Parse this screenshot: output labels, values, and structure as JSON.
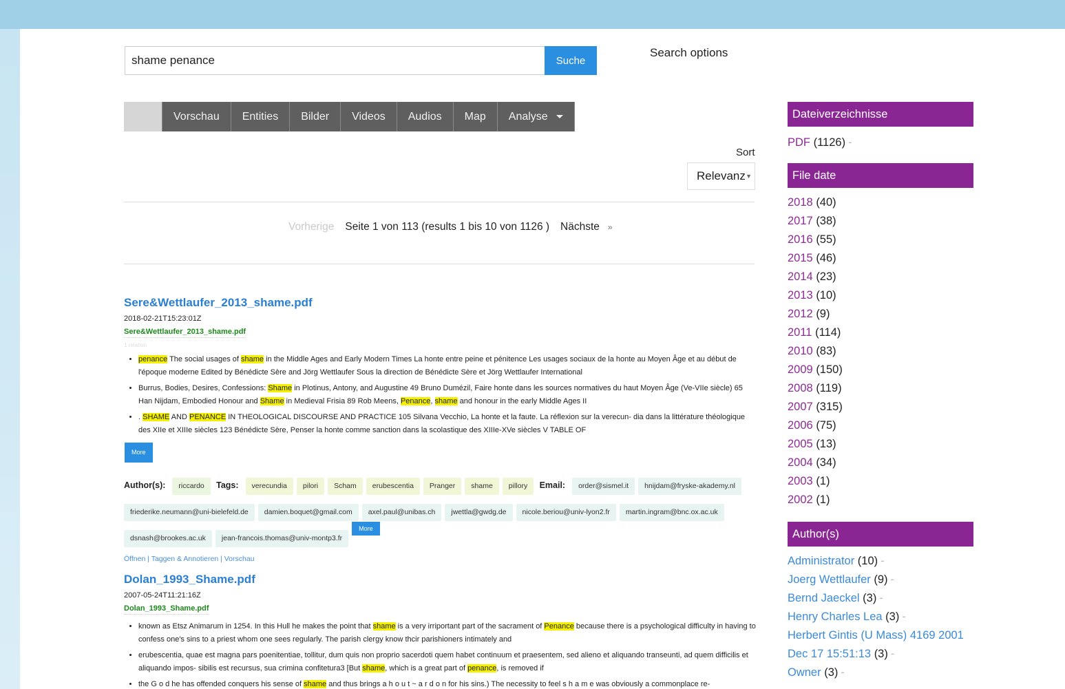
{
  "search": {
    "query": "shame penance",
    "button": "Suche",
    "options_label": "Search options"
  },
  "tabs": [
    {
      "label": ""
    },
    {
      "label": "Vorschau"
    },
    {
      "label": "Entities"
    },
    {
      "label": "Bilder"
    },
    {
      "label": "Videos"
    },
    {
      "label": "Audios"
    },
    {
      "label": "Map"
    },
    {
      "label": "Analyse"
    }
  ],
  "sort": {
    "label": "Sort",
    "value": "Relevanz"
  },
  "pager": {
    "prev": "Vorherige",
    "status": "Seite 1 von 113 (results 1 bis 10 von 1126 )",
    "next": "Nächste",
    "next_symbol": "»"
  },
  "results": [
    {
      "title": "Sere&Wettlaufer_2013_shame.pdf",
      "date": "2018-02-21T15:23:01Z",
      "file": "Sere&Wettlaufer_2013_shame.pdf",
      "tiny": "1 relation",
      "more": "More",
      "author_label": "Author(s):",
      "authors": [
        "riccardo"
      ],
      "tags_label": "Tags:",
      "tags": [
        "verecundia",
        "pilori",
        "Scham",
        "erubescentia",
        "Pranger",
        "shame",
        "pillory"
      ],
      "email_label": "Email:",
      "emails": [
        "order@sismel.it",
        "hnijdam@fryske-akademy.nl",
        "friederike.neumann@uni-bielefeld.de",
        "damien.boquet@gmail.com",
        "axel.paul@unibas.ch",
        "jwettla@gwdg.de",
        "nicole.beriou@univ-lyon2.fr",
        "martin.ingram@bnc.ox.ac.uk",
        "dsnash@brookes.ac.uk",
        "jean-francois.thomas@univ-montp3.fr"
      ],
      "emails_more": "More",
      "links": "Öffnen | Taggen & Annotieren | Vorschau"
    },
    {
      "title": "Dolan_1993_Shame.pdf",
      "date": "2007-05-24T11:21:16Z",
      "file": "Dolan_1993_Shame.pdf"
    }
  ],
  "snippets_r1": {
    "s1a": "penance",
    "s1b": " The social usages of ",
    "s1c": "shame",
    "s1d": " in the Middle Ages and Early Modern Times La honte entre peine et pénitence Les usages sociaux de la honte au Moyen Âge et au début de l'époque moderne Edited by Bénédicte Sère and Jörg Wettlaufer Sous la direction de Bénédicte Sère et Jörg Wettlaufer International",
    "s2a": "Burrus, Bodies, Desires, Confessions: ",
    "s2b": "Shame",
    "s2c": " in Plotinus, Antony, and Augustine 49 Bruno Dumézil, Faire honte dans les sources normatives du haut Moyen Âge (Ve-VIIe siècle) 65 Han Nijdam, Embodied Honour and ",
    "s2d": "Shame",
    "s2e": " in Medieval Frisia 89 Rob Meens, ",
    "s2f": "Penance",
    "s2g": ", ",
    "s2h": "shame",
    "s2i": " and honour in the early Middle Ages II",
    "s3a": ". ",
    "s3b": "SHAME",
    "s3c": " AND ",
    "s3d": "PENANCE",
    "s3e": " IN THEOLOGICAL DISCOURSE AND PRACTICE 105 Silvana Vecchio, La honte et la faute. La réflexion sur la verecun- dia dans la littérature théologique des XIIe et XIIIe siècles 123 Bénédicte Sère, Penser la honte comme sanction dans la scolastique des XIIIe-XVe siècles V TABLE OF"
  },
  "snippets_r2": {
    "s1a": "known as Etsz Animarum in 1254. In this Hull he makes the point that ",
    "s1b": "shame",
    "s1c": " is a very irriportant part of the sacrament of ",
    "s1d": "Penance",
    "s1e": " because there is a psychological difficulty in having to confess one's sins to a priest whom one sees regularly. The parish clergy know thcir parishioners intimately and",
    "s2a": "erubescentia, quae est magna pars poenitentiae, tollitur, dum quis non proprio sacerdoti quem habet continuum et praesentem, sed alieno et aliquando transeunti, ad quem difficilis et aliquando impos- sibilis est recursus, sua crimina confitetura3 [But ",
    "s2b": "shame",
    "s2c": ", which is a great part of ",
    "s2d": "penance",
    "s2e": ", is removed if",
    "s3a": "the G o d he has offended conquers his sense of ",
    "s3b": "shame",
    "s3c": " and thus brings a h o u t ~ a r d o n for his sins.) The necessity to feel s h a m e was obviously a commonplace re-"
  },
  "sidebar": {
    "dateiverzeichnisse": {
      "title": "Dateiverzeichnisse",
      "items": [
        {
          "label": "PDF",
          "count": "(1126)"
        }
      ]
    },
    "file_date": {
      "title": "File date",
      "items": [
        {
          "label": "2018",
          "count": "(40)"
        },
        {
          "label": "2017",
          "count": "(38)"
        },
        {
          "label": "2016",
          "count": "(55)"
        },
        {
          "label": "2015",
          "count": "(46)"
        },
        {
          "label": "2014",
          "count": "(23)"
        },
        {
          "label": "2013",
          "count": "(10)"
        },
        {
          "label": "2012",
          "count": "(9)"
        },
        {
          "label": "2011",
          "count": "(114)"
        },
        {
          "label": "2010",
          "count": "(83)"
        },
        {
          "label": "2009",
          "count": "(150)"
        },
        {
          "label": "2008",
          "count": "(119)"
        },
        {
          "label": "2007",
          "count": "(315)"
        },
        {
          "label": "2006",
          "count": "(75)"
        },
        {
          "label": "2005",
          "count": "(13)"
        },
        {
          "label": "2004",
          "count": "(34)"
        },
        {
          "label": "2003",
          "count": "(1)"
        },
        {
          "label": "2002",
          "count": "(1)"
        }
      ]
    },
    "authors": {
      "title": "Author(s)",
      "items": [
        {
          "label": "Administrator",
          "count": "(10)"
        },
        {
          "label": "Joerg Wettlaufer",
          "count": "(9)"
        },
        {
          "label": "Bernd Jaeckel",
          "count": "(3)"
        },
        {
          "label": "Henry Charles Lea",
          "count": "(3)"
        },
        {
          "label": "Herbert Gintis (U Mass) 4169 2001",
          "count": ""
        },
        {
          "label": "Dec 17 15:51:13",
          "count": "(3)"
        },
        {
          "label": "Owner",
          "count": "(3)"
        }
      ]
    }
  },
  "colors": {
    "accent": "#2a8fe0",
    "facet_header": "#8a2594",
    "highlight": "#f5f000",
    "facet_link": "#8d2b94"
  }
}
